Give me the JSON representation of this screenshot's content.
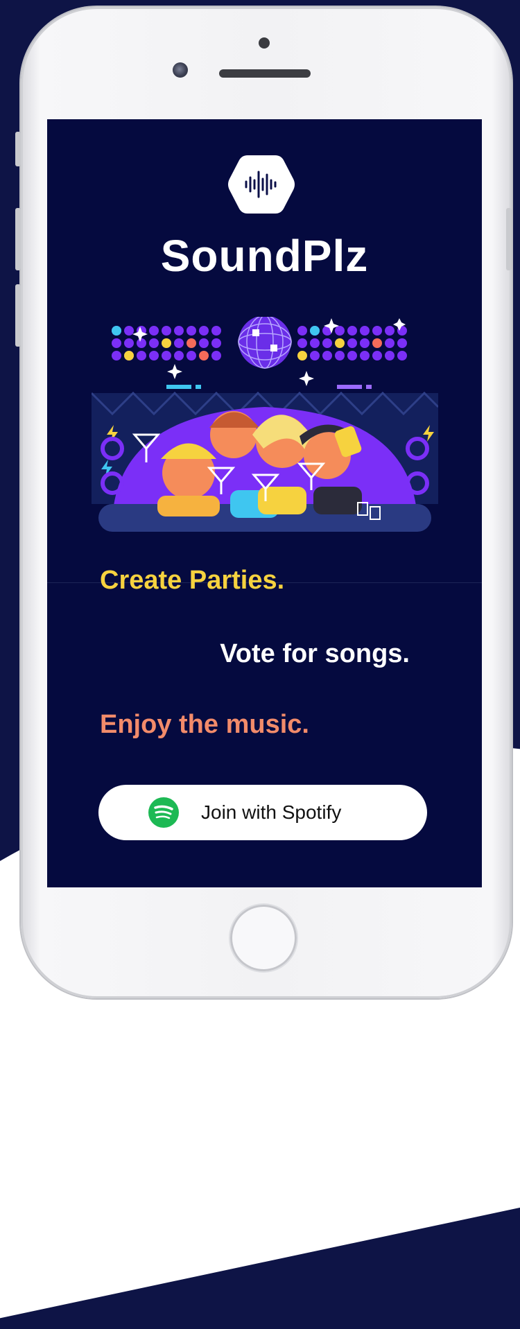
{
  "app": {
    "title": "SoundPlz"
  },
  "taglines": {
    "create": "Create Parties.",
    "vote": "Vote for songs.",
    "enjoy": "Enjoy the music."
  },
  "cta": {
    "label": "Join with Spotify"
  },
  "icons": {
    "logo": "soundwave-icon",
    "cta": "spotify-icon",
    "illustration": "party-illustration"
  },
  "colors": {
    "background": "#050a3f",
    "tagline_create": "#f6d23f",
    "tagline_vote": "#ffffff",
    "tagline_enjoy": "#f28b6a",
    "spotify_green": "#1db954",
    "accent_purple": "#7b2ff7"
  }
}
